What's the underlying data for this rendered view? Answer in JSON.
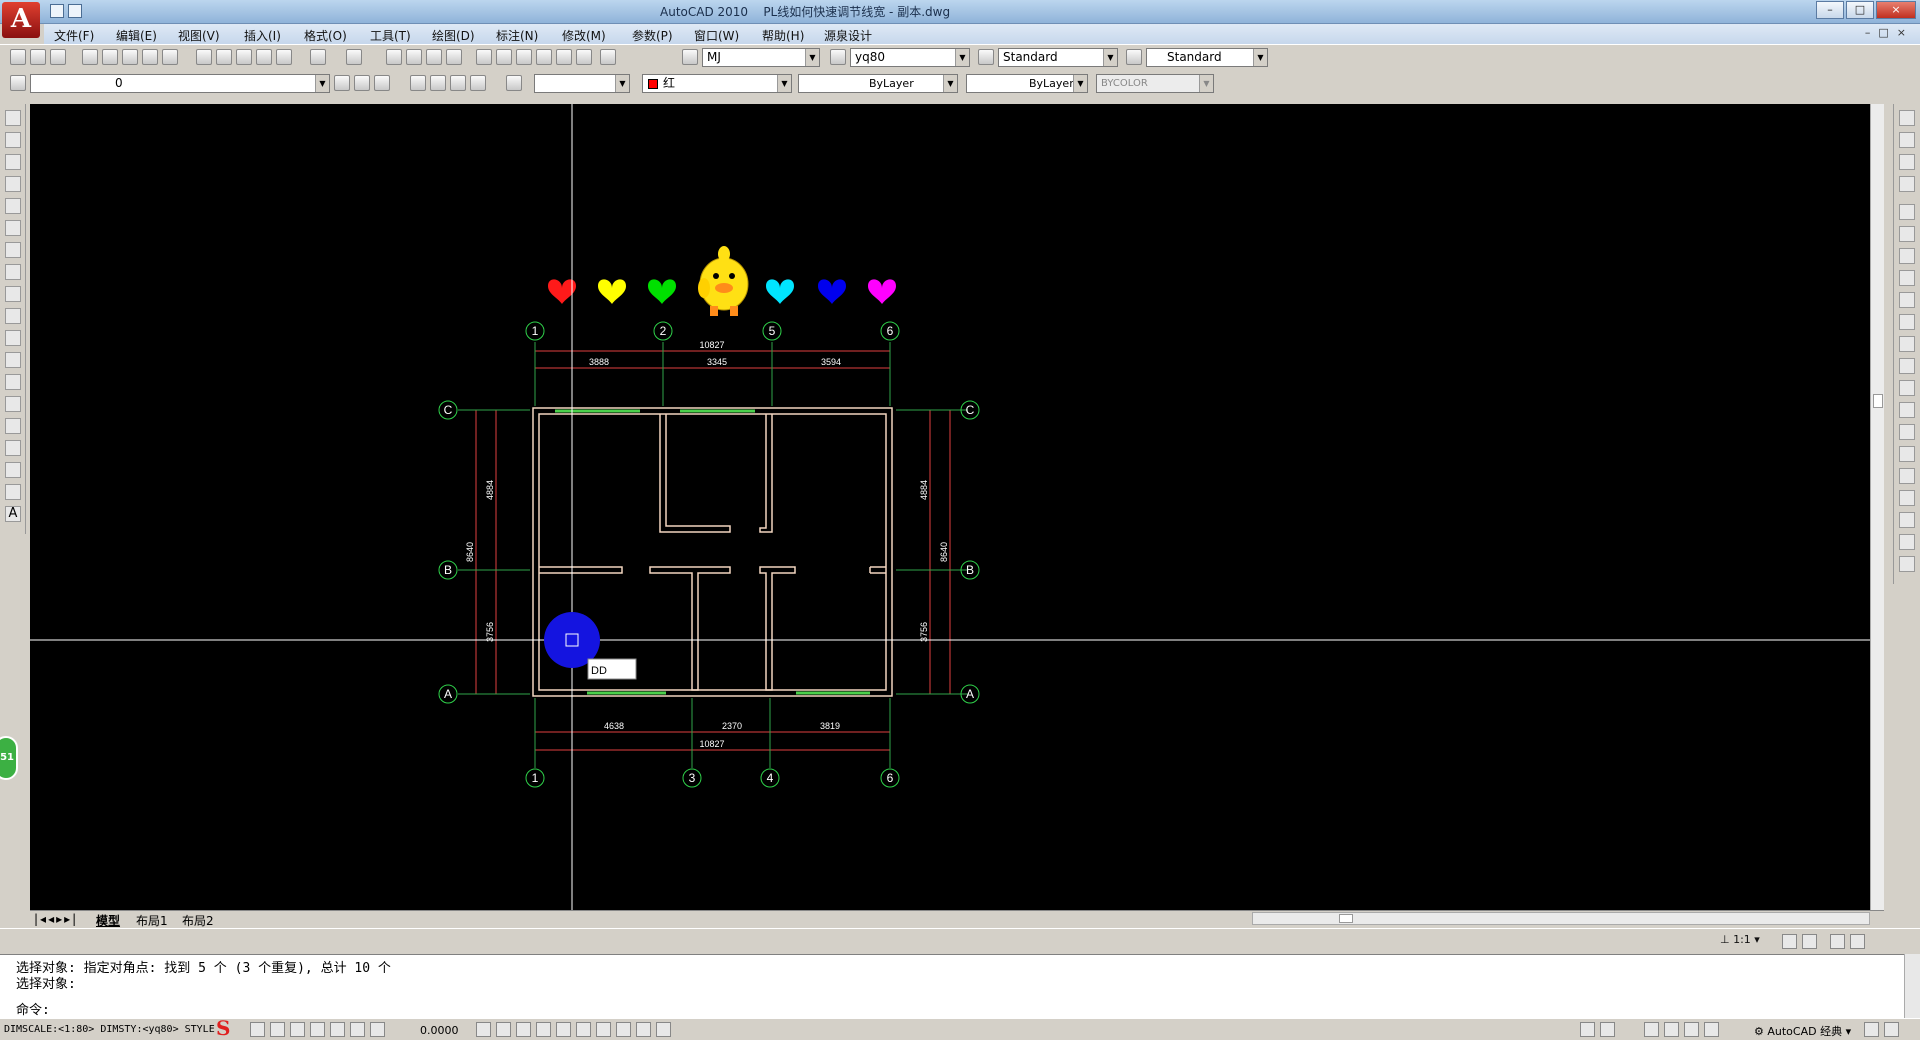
{
  "window": {
    "app_name": "AutoCAD 2010",
    "document": "PL线如何快速调节线宽 - 副本.dwg",
    "controls": [
      "–",
      "□",
      "×"
    ]
  },
  "menus": [
    "文件(F)",
    "编辑(E)",
    "视图(V)",
    "插入(I)",
    "格式(O)",
    "工具(T)",
    "绘图(D)",
    "标注(N)",
    "修改(M)",
    "参数(P)",
    "窗口(W)",
    "帮助(H)",
    "源泉设计"
  ],
  "toolbar1": {
    "text_style": "MJ",
    "dim_style": "yq80",
    "table_style": "Standard",
    "multileader_style": "Standard"
  },
  "toolbar2": {
    "layer": "0",
    "color": "红",
    "color_hex": "#ff0000",
    "linetype": "ByLayer",
    "lineweight": "ByLayer",
    "plotstyle": "BYCOLOR"
  },
  "drawing": {
    "grid_top": [
      "1",
      "2",
      "5",
      "6"
    ],
    "grid_bottom": [
      "1",
      "3",
      "4",
      "6"
    ],
    "grid_left": [
      "C",
      "B",
      "A"
    ],
    "grid_right": [
      "C",
      "B",
      "A"
    ],
    "dims_top_total": "10827",
    "dims_top_parts": [
      "3888",
      "3345",
      "3594"
    ],
    "dims_bottom_total": "10827",
    "dims_bottom_parts": [
      "4638",
      "2370",
      "3819"
    ],
    "dims_left_total": "8640",
    "dims_left_parts": [
      "4884",
      "3756"
    ],
    "dims_right_total": "8640",
    "dims_right_parts": [
      "4884",
      "3756"
    ],
    "dynamic_input": "DD",
    "heart_colors": [
      "#ff1a1a",
      "#ffff00",
      "#00e000",
      "#00e5ff",
      "#0000ee",
      "#ff00ff"
    ]
  },
  "layout_tabs": [
    "模型",
    "布局1",
    "布局2"
  ],
  "annotation_scale": "1:1",
  "command": {
    "history": [
      "选择对象: 指定对角点: 找到 5 个 (3 个重复), 总计 10 个",
      "选择对象:"
    ],
    "prompt": "命令:"
  },
  "status": {
    "sysvars": "DIMSCALE:<1:80> DIMSTY:<yq80> STYLE",
    "coordinate": "0.0000",
    "workspace": "AutoCAD 经典"
  },
  "float_badge": "51"
}
